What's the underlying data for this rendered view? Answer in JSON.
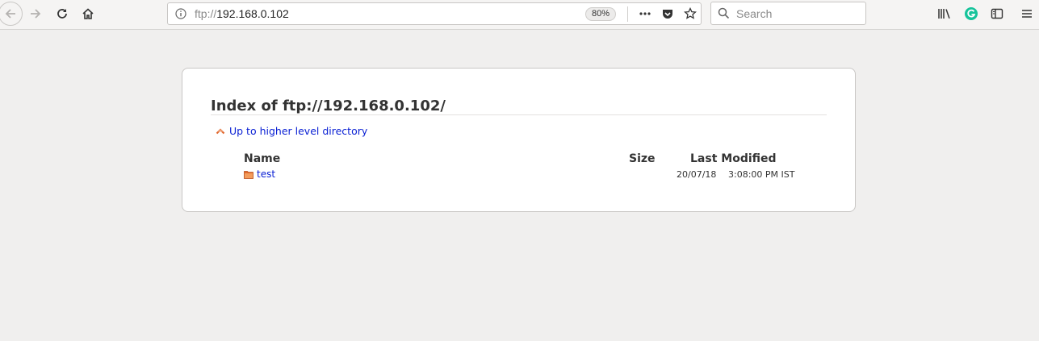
{
  "browser": {
    "url_protocol": "ftp://",
    "url_host": "192.168.0.102",
    "zoom": "80%",
    "search_placeholder": "Search"
  },
  "page": {
    "title": "Index of ftp://192.168.0.102/",
    "up_link": "Up to higher level directory",
    "columns": {
      "name": "Name",
      "size": "Size",
      "modified": "Last Modified"
    },
    "rows": [
      {
        "name": "test",
        "size": "",
        "date": "20/07/18",
        "time": "3:08:00 PM IST"
      }
    ]
  },
  "colors": {
    "link": "#0b21d4",
    "grammarly": "#15c39a",
    "up_arrow": "#e0662c"
  },
  "icons": [
    "back-arrow-icon",
    "forward-arrow-icon",
    "reload-icon",
    "home-icon",
    "info-icon",
    "more-dots-icon",
    "pocket-icon",
    "bookmark-star-icon",
    "search-icon",
    "library-icon",
    "grammarly-icon",
    "sidebar-icon",
    "menu-icon",
    "up-arrow-icon",
    "folder-icon"
  ]
}
